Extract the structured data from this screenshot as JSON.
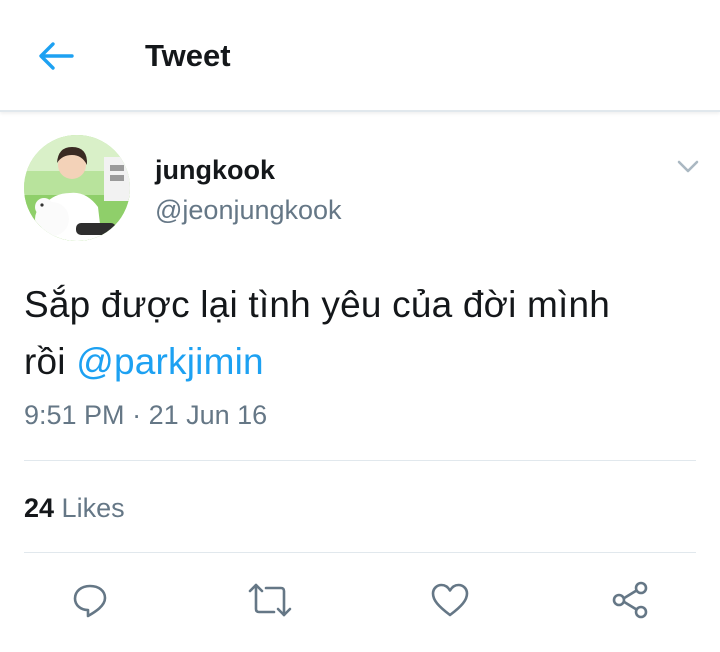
{
  "header": {
    "title": "Tweet",
    "back_icon": "arrow-left-icon",
    "accent": "#1da1f2"
  },
  "tweet": {
    "author_name": "jungkook",
    "author_handle": "@jeonjungkook",
    "text_line1": "Sắp được lại tình yêu của đời mình",
    "text_prefix2": "rồi ",
    "mention": "@parkjimin",
    "time": "9:51 PM",
    "separator": " · ",
    "date": "21 Jun 16",
    "likes_count": "24",
    "likes_label": " Likes"
  },
  "actions": {
    "reply": "reply-icon",
    "retweet": "retweet-icon",
    "like": "heart-icon",
    "share": "share-icon"
  },
  "colors": {
    "text": "#14171a",
    "secondary": "#657786",
    "divider": "#e1e8ed",
    "mention": "#1da1f2"
  }
}
